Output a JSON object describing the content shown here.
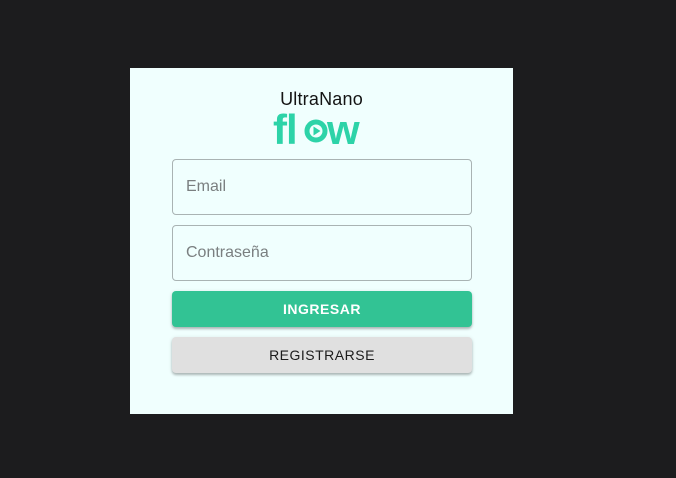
{
  "brand": {
    "name_top": "UltraNano",
    "name_bottom": "flow",
    "accent_color": "#2dd3a8"
  },
  "form": {
    "email_placeholder": "Email",
    "email_value": "",
    "password_placeholder": "Contraseña",
    "password_value": "",
    "login_label": "INGRESAR",
    "register_label": "REGISTRARSE"
  },
  "colors": {
    "page_background": "#1c1c1e",
    "card_background": "#f0fffe",
    "login_button": "#32c394",
    "register_button": "#e0e0e0"
  }
}
